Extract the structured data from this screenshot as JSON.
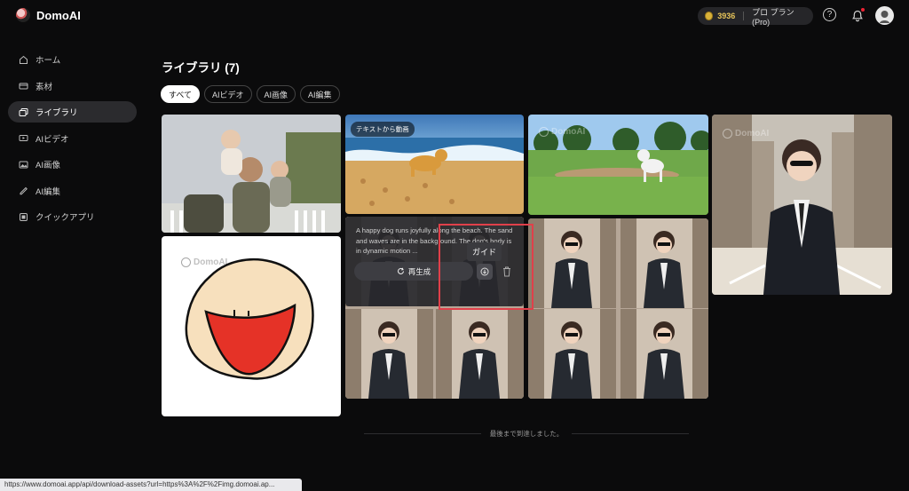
{
  "app": {
    "name": "DomoAI"
  },
  "header": {
    "credits": "3936",
    "plan": "プロ プラン(Pro)"
  },
  "sidebar": {
    "items": [
      {
        "label": "ホーム",
        "icon": "home-icon"
      },
      {
        "label": "素材",
        "icon": "material-icon"
      },
      {
        "label": "ライブラリ",
        "icon": "library-icon",
        "active": true
      },
      {
        "label": "AIビデオ",
        "icon": "video-icon"
      },
      {
        "label": "AI画像",
        "icon": "image-icon"
      },
      {
        "label": "AI編集",
        "icon": "edit-icon"
      },
      {
        "label": "クイックアプリ",
        "icon": "apps-icon"
      }
    ]
  },
  "main": {
    "title": "ライブラリ (7)",
    "filters": [
      "すべて",
      "AIビデオ",
      "AI画像",
      "AI編集"
    ],
    "cards": {
      "dog": {
        "badge": "テキストから動画",
        "prompt": "A happy dog runs joyfully along the beach. The sand and waves are in the background. The dog's body is in dynamic motion ...",
        "regenerate_label": "再生成"
      }
    },
    "tooltip": "ガイド",
    "end_message": "最後まで到達しました。"
  },
  "watermark": "DomoAI",
  "status_bar": {
    "url": "https://www.domoai.app/api/download-assets?url=https%3A%2F%2Fimg.domoai.ap..."
  },
  "colors": {
    "accent_red": "#e0404a",
    "coin": "#d9b23a",
    "background": "#0b0b0c"
  }
}
